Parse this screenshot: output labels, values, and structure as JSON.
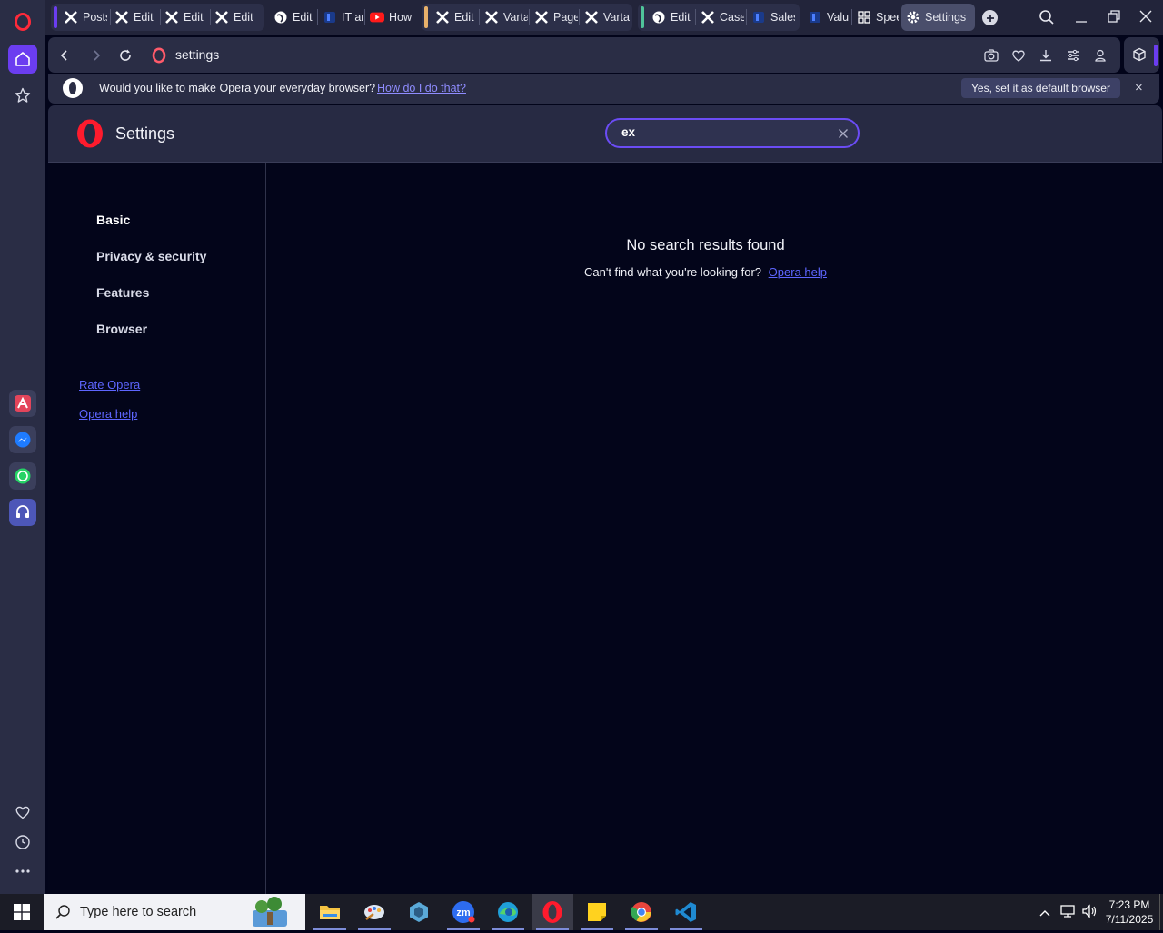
{
  "tabs": [
    {
      "label": "Posts",
      "icon": "x-logo-icon"
    },
    {
      "label": "Edit",
      "icon": "x-logo-icon"
    },
    {
      "label": "Edit",
      "icon": "x-logo-icon"
    },
    {
      "label": "Edit",
      "icon": "x-logo-icon"
    },
    {
      "label": "Edit",
      "icon": "globe-icon"
    },
    {
      "label": "IT ar",
      "icon": "site-icon"
    },
    {
      "label": "How",
      "icon": "youtube-icon"
    },
    {
      "label": "Edit",
      "icon": "x-logo-icon"
    },
    {
      "label": "Varta",
      "icon": "x-logo-icon"
    },
    {
      "label": "Page",
      "icon": "x-logo-icon"
    },
    {
      "label": "Varta",
      "icon": "x-logo-icon"
    },
    {
      "label": "Edit",
      "icon": "globe-icon"
    },
    {
      "label": "Case",
      "icon": "x-logo-icon"
    },
    {
      "label": "Sales",
      "icon": "site-icon"
    },
    {
      "label": "Valu",
      "icon": "site-icon"
    },
    {
      "label": "Spee",
      "icon": "grid-icon"
    },
    {
      "label": "Settings",
      "icon": "gear-icon"
    }
  ],
  "address": {
    "url": "settings"
  },
  "default_bar": {
    "prompt": "Would you like to make Opera your everyday browser?",
    "link": "How do I do that?",
    "button": "Yes, set it as default browser",
    "close": "×"
  },
  "settings": {
    "title": "Settings",
    "search_value": "ex",
    "nav": [
      "Basic",
      "Privacy & security",
      "Features",
      "Browser"
    ],
    "links": [
      "Rate Opera",
      "Opera help"
    ],
    "no_results": "No search results found",
    "cant_find": "Can't find what you're looking for?",
    "help_link": "Opera help"
  },
  "taskbar": {
    "search_placeholder": "Type here to search",
    "time": "7:23 PM",
    "date": "7/11/2025"
  },
  "colors": {
    "accent": "#6b3df0",
    "link": "#5e66ff",
    "opera_red": "#ff1b2d"
  }
}
